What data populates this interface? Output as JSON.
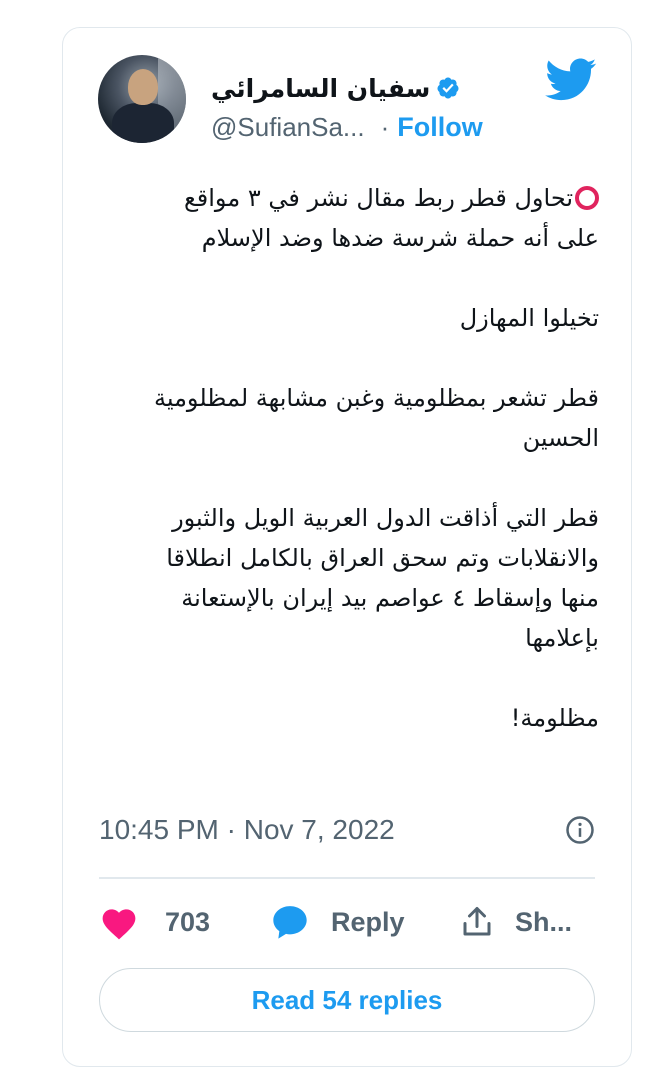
{
  "author": {
    "display_name": "سفيان السامرائي",
    "handle": "@SufianSa...",
    "separator": "·",
    "follow_label": "Follow",
    "verified": true
  },
  "tweet": {
    "paragraphs": [
      [
        "تحاول قطر ربط مقال نشر في ٣ مواقع",
        "على أنه حملة شرسة ضدها وضد الإسلام"
      ],
      [
        "تخيلوا المهازل"
      ],
      [
        "قطر تشعر بمظلومية وغبن مشابهة لمظلومية",
        "الحسين"
      ],
      [
        "قطر التي أذاقت الدول العربية الويل والثبور",
        "والانقلابات وتم سحق العراق بالكامل انطلاقا",
        "منها وإسقاط ٤ عواصم بيد إيران بالإستعانة",
        "بإعلامها"
      ],
      [
        "مظلومة!"
      ]
    ],
    "timestamp": "10:45 PM · Nov 7, 2022"
  },
  "actions": {
    "like_count": "703",
    "reply_label": "Reply",
    "share_label": "Sh..."
  },
  "read_replies_label": "Read 54 replies",
  "colors": {
    "twitter_blue": "#1d9bf0",
    "like_pink": "#f91880",
    "text": "#0f1419",
    "muted": "#536471",
    "emoji_red": "#e0245e"
  },
  "icons": [
    "twitter-bird-icon",
    "verified-badge-icon",
    "info-icon",
    "heart-icon",
    "reply-bubble-icon",
    "share-icon",
    "red-circle-emoji"
  ]
}
